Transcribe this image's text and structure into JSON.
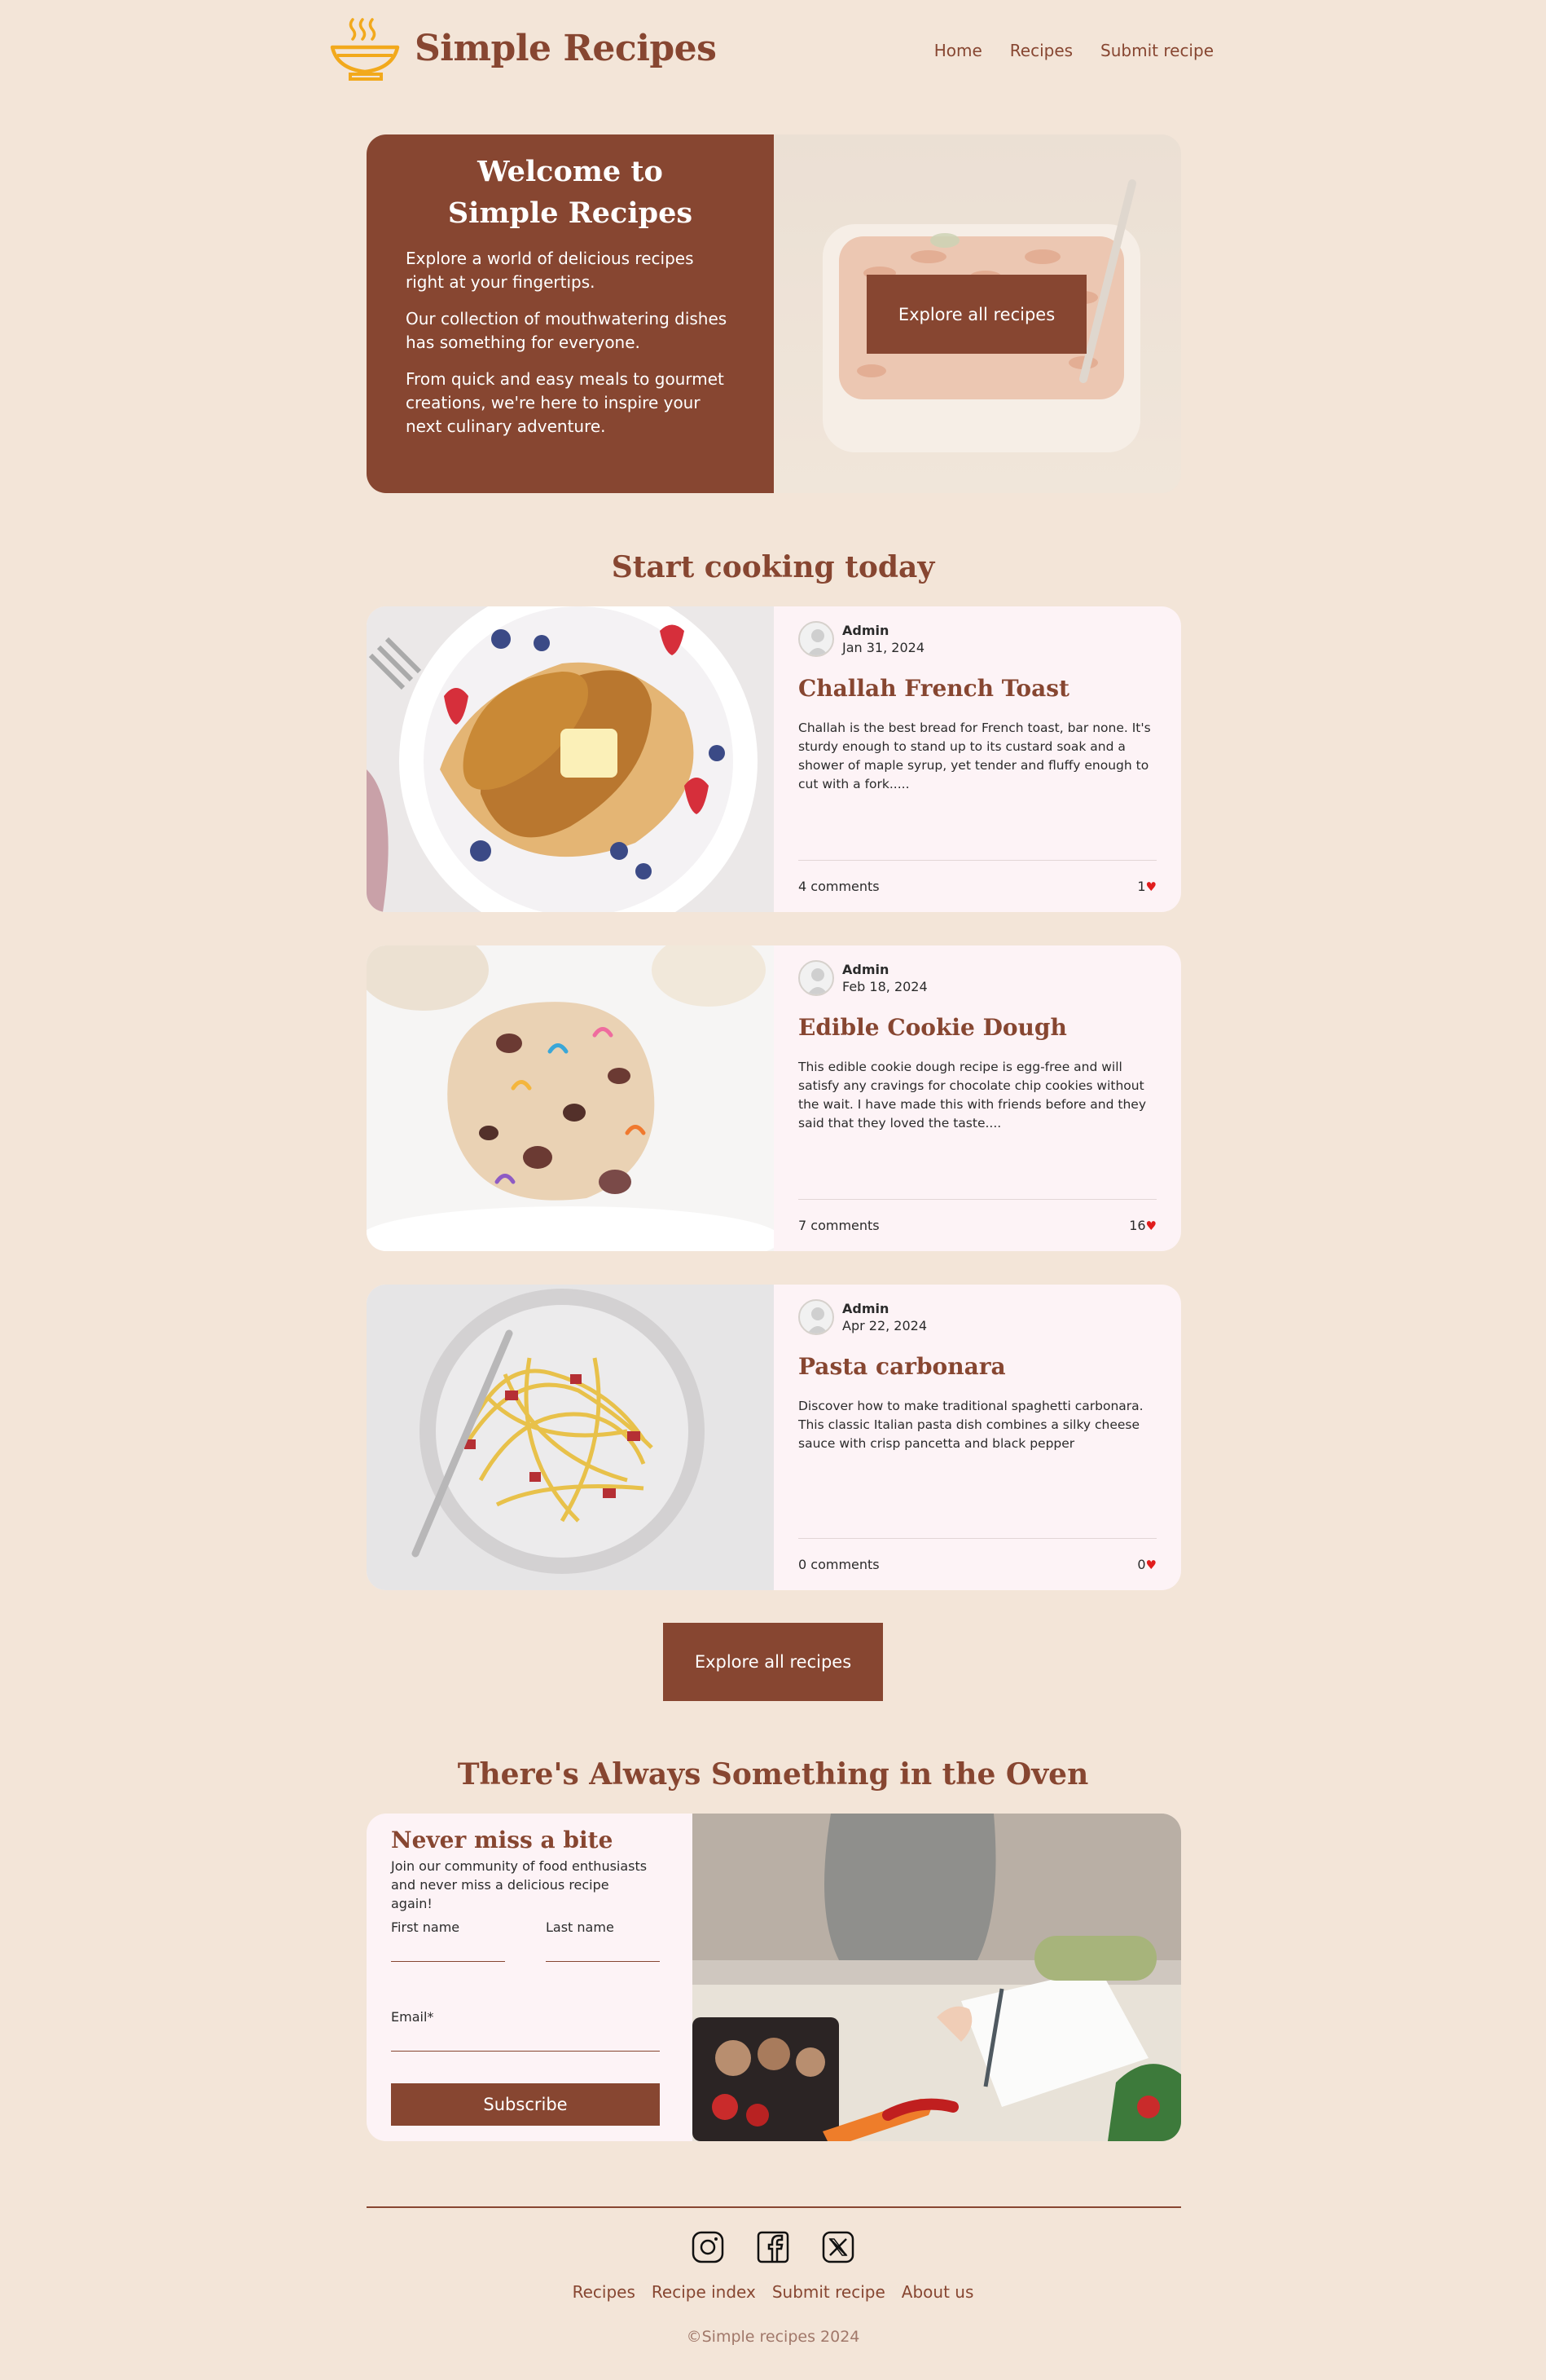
{
  "header": {
    "site_title": "Simple Recipes",
    "nav": [
      "Home",
      "Recipes",
      "Submit recipe"
    ]
  },
  "hero": {
    "title_line1": "Welcome to",
    "title_line2": "Simple Recipes",
    "paragraphs": [
      "Explore a world of delicious recipes right at your fingertips.",
      "Our collection of mouthwatering dishes has something for everyone.",
      "From quick and easy meals to gourmet creations, we're here to inspire your next culinary adventure."
    ],
    "button": "Explore all recipes"
  },
  "recipes_section": {
    "title": "Start cooking today",
    "cards": [
      {
        "author": "Admin",
        "date": "Jan 31, 2024",
        "title": "Challah French Toast",
        "excerpt": "Challah is the best bread for French toast, bar none. It's sturdy enough to stand up to its custard soak and a shower of maple syrup, yet tender and fluffy enough to cut with a fork.....",
        "comments": "4 comments",
        "likes": "1"
      },
      {
        "author": "Admin",
        "date": "Feb 18, 2024",
        "title": "Edible Cookie Dough",
        "excerpt": "This edible cookie dough recipe is egg-free and will satisfy any cravings for chocolate chip cookies without the wait. I have made this with friends before and they said that they loved the taste....",
        "comments": "7 comments",
        "likes": "16"
      },
      {
        "author": "Admin",
        "date": "Apr 22, 2024",
        "title": "Pasta carbonara",
        "excerpt": "Discover how to make traditional spaghetti carbonara. This classic Italian pasta dish combines a silky cheese sauce with crisp pancetta and black pepper",
        "comments": "0 comments",
        "likes": "0"
      }
    ],
    "button": "Explore all recipes"
  },
  "newsletter": {
    "section_title": "There's Always Something in the Oven",
    "title": "Never miss a bite",
    "subtitle": "Join our community of food enthusiasts and never miss a delicious recipe again!",
    "first_name_label": "First name",
    "last_name_label": "Last name",
    "email_label": "Email*",
    "button": "Subscribe"
  },
  "footer": {
    "social_icons": [
      "instagram-icon",
      "facebook-icon",
      "x-icon"
    ],
    "nav": [
      "Recipes",
      "Recipe index",
      "Submit recipe",
      "About us"
    ],
    "copyright": "©Simple recipes 2024"
  },
  "colors": {
    "background": "#f3e5d8",
    "brand_brown": "#874631",
    "card_background": "#fdf3f6",
    "logo_yellow": "#f2a91c",
    "heart_red": "#e11d1d"
  }
}
